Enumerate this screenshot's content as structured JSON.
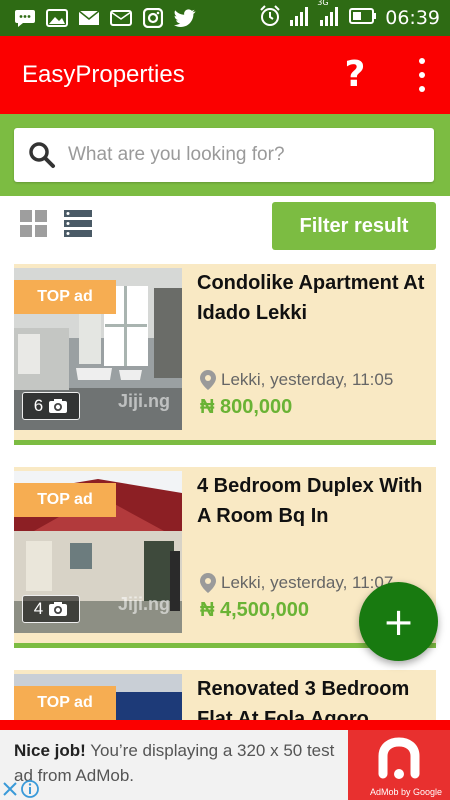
{
  "status_bar": {
    "time": "06:39",
    "network": "3G",
    "icons": [
      "message-icon",
      "image-icon",
      "mail-icon",
      "mail-outline-icon",
      "instagram-icon",
      "twitter-icon",
      "alarm-icon",
      "signal-icon",
      "signal-3g-icon",
      "battery-icon"
    ]
  },
  "app_bar": {
    "title": "EasyProperties",
    "help_glyph": "?",
    "menu_icon": "overflow-menu-icon"
  },
  "search": {
    "placeholder": "What are you looking for?"
  },
  "toolbar": {
    "grid_view_icon": "grid-view-icon",
    "list_view_icon": "list-view-icon",
    "filter_label": "Filter result"
  },
  "listings": [
    {
      "title": "Condolike Apartment At Idado Lekki",
      "badge": "TOP ad",
      "photos": "6",
      "location": "Lekki, yesterday, 11:05",
      "price": "₦ 800,000",
      "watermark": "Jiji.ng"
    },
    {
      "title": "4 Bedroom Duplex With A Room Bq In",
      "badge": "TOP ad",
      "photos": "4",
      "location": "Lekki, yesterday, 11:07",
      "price": "₦ 4,500,000",
      "watermark": "Jiji.ng"
    },
    {
      "title": "Renovated 3 Bedroom Flat At Fola Agoro,",
      "badge": "TOP ad"
    }
  ],
  "fab": {
    "label": "+"
  },
  "ad": {
    "bold": "Nice job!",
    "text": " You’re displaying a 320 x 50 test ad from AdMob.",
    "brand": "AdMob by Google"
  },
  "colors": {
    "status_bar": "#2e6b14",
    "app_bar": "#fb0000",
    "accent_green": "#7cbc42",
    "card_bg": "#f9e9c4",
    "badge": "#f6ad52",
    "fab": "#187a10"
  }
}
